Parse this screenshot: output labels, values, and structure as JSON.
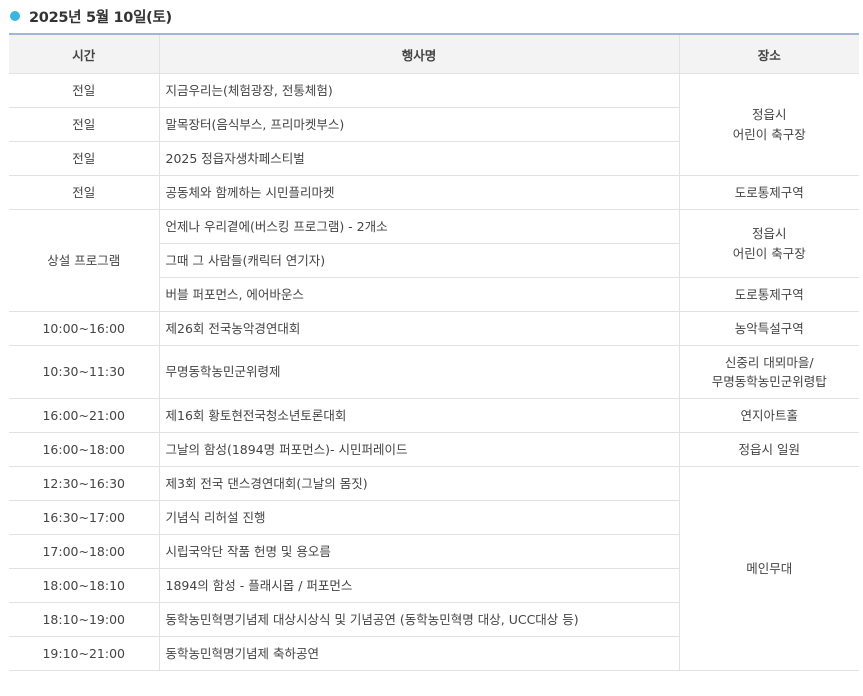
{
  "date_title": "2025년 5월 10일(토)",
  "columns": {
    "time": "시간",
    "event": "행사명",
    "place": "장소"
  },
  "rows": [
    {
      "time": "전일",
      "event": "지금우리는(체험광장, 전통체험)"
    },
    {
      "time": "전일",
      "event": "말목장터(음식부스, 프리마켓부스)"
    },
    {
      "time": "전일",
      "event": "2025 정읍자생차페스티벌"
    },
    {
      "time": "전일",
      "event": "공동체와 함께하는 시민플리마켓"
    },
    {
      "time": "상설 프로그램",
      "event": "언제나 우리곁에(버스킹 프로그램) - 2개소"
    },
    {
      "event": "그때 그 사람들(캐릭터 연기자)"
    },
    {
      "event": "버블 퍼포먼스, 에어바운스"
    },
    {
      "time": "10:00~16:00",
      "event": "제26회 전국농악경연대회"
    },
    {
      "time": "10:30~11:30",
      "event": "무명동학농민군위령제"
    },
    {
      "time": "16:00~21:00",
      "event": "제16회 황토현전국청소년토론대회"
    },
    {
      "time": "16:00~18:00",
      "event": "그날의 함성(1894명 퍼포먼스)- 시민퍼레이드"
    },
    {
      "time": "12:30~16:30",
      "event": "제3회 전국 댄스경연대회(그날의 몸짓)"
    },
    {
      "time": "16:30~17:00",
      "event": "기념식 리허설 진행"
    },
    {
      "time": "17:00~18:00",
      "event": "시립국악단 작품 헌명 및 용오름"
    },
    {
      "time": "18:00~18:10",
      "event": "1894의 함성 - 플래시몹 / 퍼포먼스"
    },
    {
      "time": "18:10~19:00",
      "event": "동학농민혁명기념제 대상시상식 및 기념공연 (동학농민혁명 대상, UCC대상 등)"
    },
    {
      "time": "19:10~21:00",
      "event": "동학농민혁명기념제 축하공연"
    }
  ],
  "places": {
    "p1": {
      "line1": "정읍시",
      "line2": "어린이 축구장"
    },
    "p2": "도로통제구역",
    "p3": {
      "line1": "정읍시",
      "line2": "어린이 축구장"
    },
    "p4": "도로통제구역",
    "p5": "농악특설구역",
    "p6": {
      "line1": "신중리 대뫼마을/",
      "line2": "무명동학농민군위령탑"
    },
    "p7": "연지아트홀",
    "p8": "정읍시 일원",
    "p9": "메인무대"
  },
  "colors": {
    "accent": "#3bb6e0",
    "header_bg": "#f3f3f3",
    "border": "#e2e2e2",
    "top_border": "#a3b5d6"
  }
}
